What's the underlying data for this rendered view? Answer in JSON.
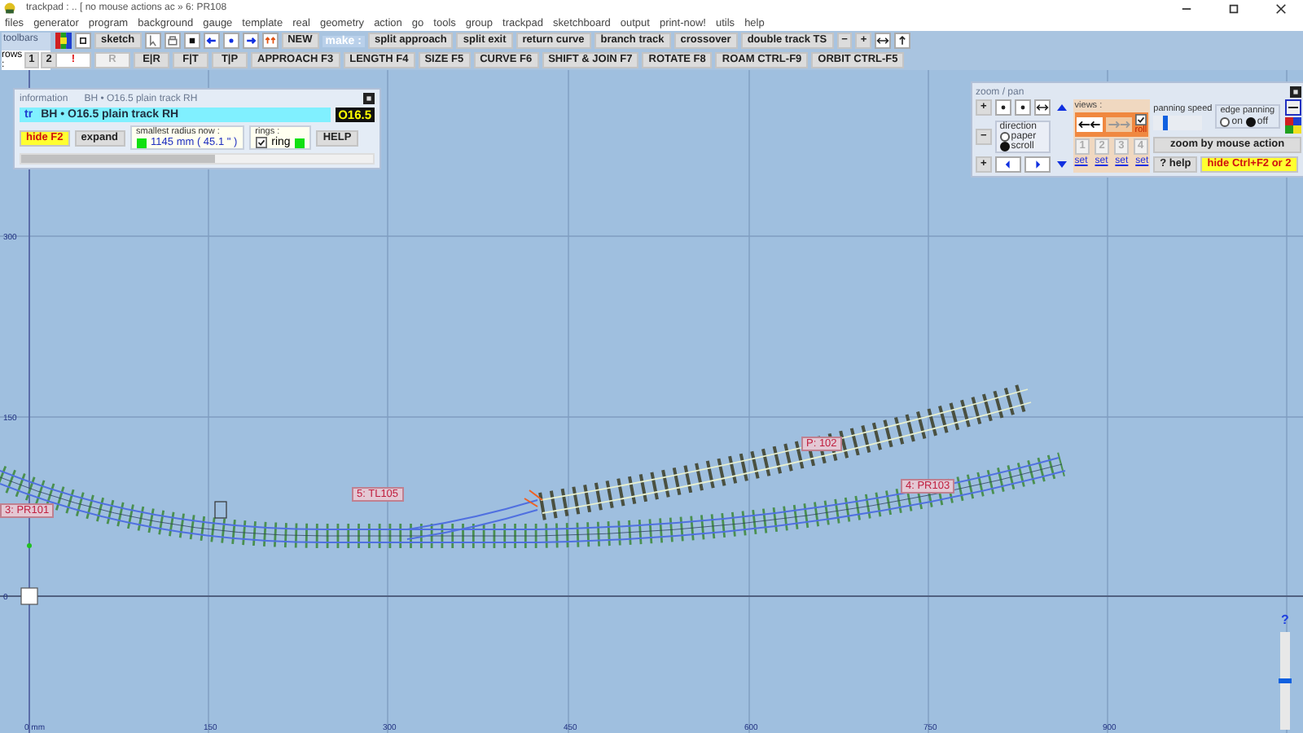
{
  "window": {
    "title": "trackpad :  ..  [ no mouse actions ac »  6: PR108"
  },
  "menu": [
    "files",
    "generator",
    "program",
    "background",
    "gauge",
    "template",
    "real",
    "geometry",
    "action",
    "go",
    "tools",
    "group",
    "trackpad",
    "sketchboard",
    "output",
    "print-now!",
    "utils",
    "help"
  ],
  "toolbar": {
    "title": "toolbars",
    "sketch": "sketch",
    "new": "NEW",
    "make_label": "make :",
    "make_buttons": [
      "split  approach",
      "split  exit",
      "return curve",
      "branch track",
      "crossover",
      "double track TS"
    ],
    "zoom_buttons": [
      "−",
      "+"
    ],
    "rows_label": "rows :",
    "rows": [
      "1",
      "2"
    ],
    "warn": "!",
    "r_button": {
      "label": "R",
      "disabled": true
    },
    "mode_buttons": [
      "E|R",
      "F|T",
      "T|P"
    ],
    "function_buttons": [
      "APPROACH  F3",
      "LENGTH  F4",
      "SIZE  F5",
      "CURVE  F6",
      "SHIFT & JOIN  F7",
      "ROTATE  F8",
      "ROAM  CTRL-F9",
      "ORBIT  CTRL-F5"
    ]
  },
  "info_panel": {
    "title": "information",
    "subtitle": "BH • O16.5 plain track  RH",
    "tag": "tr",
    "description": "BH • O16.5  plain track   RH",
    "gauge_badge": "O16.5",
    "hide_button": "hide  F2",
    "expand_button": "expand",
    "radius_label": "smallest  radius  now :",
    "radius_value": "1145 mm ( 45.1 \" )",
    "rings_label": "rings :",
    "ring": {
      "label": "ring",
      "checked": true
    },
    "help_button": "HELP"
  },
  "zoom_panel": {
    "title": "zoom / pan",
    "step_buttons": [
      "+",
      "−",
      "+"
    ],
    "direction": {
      "label": "direction",
      "options": [
        {
          "label": "paper",
          "selected": false
        },
        {
          "label": "scroll",
          "selected": true
        }
      ]
    },
    "views": {
      "label": "views :",
      "roll": {
        "label": "roll",
        "checked": true
      },
      "slots": [
        "1",
        "2",
        "3",
        "4"
      ],
      "set_links": [
        "set",
        "set",
        "set",
        "set"
      ]
    },
    "panning_speed": {
      "label": "panning speed",
      "level": 0.2
    },
    "edge_panning": {
      "label": "edge panning",
      "options": [
        {
          "label": "on",
          "selected": false
        },
        {
          "label": "off",
          "selected": true
        }
      ]
    },
    "zoom_mode_button": "zoom  by  mouse  action",
    "help_button": "? help",
    "hide_button": "hide   Ctrl+F2  or  2"
  },
  "canvas": {
    "x_labels": [
      "0  mm",
      "150",
      "300",
      "450",
      "600",
      "750",
      "900"
    ],
    "y_labels": [
      "300",
      "150",
      "0"
    ],
    "track_labels": [
      {
        "text": "3: PR101"
      },
      {
        "text": "5: TL105"
      },
      {
        "text": "P: 102"
      },
      {
        "text": "4: PR103"
      }
    ]
  },
  "zoom_slider": {
    "help": "?",
    "level": 0.5
  }
}
